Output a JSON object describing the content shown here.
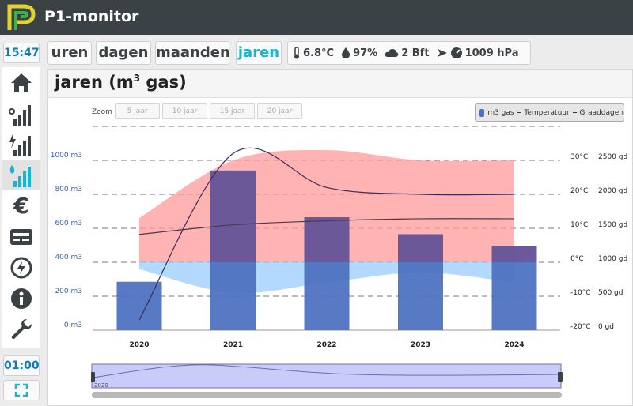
{
  "app": {
    "title": "P1-monitor"
  },
  "colors": {
    "topbar": "#3a4245",
    "accent": "#13b6d4",
    "clock": "#0b7fb5",
    "logo_yellow": "#e3d22a",
    "logo_green": "#3bb14a",
    "bar": "#4f72c0",
    "temp_band_above": "#ff9a9a",
    "temp_band_below": "#99ccff"
  },
  "clock": {
    "time": "15:47"
  },
  "sidebar": {
    "items": [
      {
        "icon": "home-icon"
      },
      {
        "icon": "signal-bars-icon"
      },
      {
        "icon": "power-bars-icon"
      },
      {
        "icon": "gas-bars-icon",
        "active": true
      },
      {
        "icon": "euro-icon"
      },
      {
        "icon": "meter-card-icon"
      },
      {
        "icon": "clock-power-icon"
      },
      {
        "icon": "info-icon"
      },
      {
        "icon": "wrench-icon"
      }
    ]
  },
  "timer": {
    "value": "01:00"
  },
  "tabs": [
    {
      "label": "uren"
    },
    {
      "label": "dagen"
    },
    {
      "label": "maanden"
    },
    {
      "label": "jaren",
      "active": true
    }
  ],
  "weather": {
    "temperature": "6.8°C",
    "humidity": "97%",
    "wind": "2 Bft",
    "pressure": "1009 hPa"
  },
  "page": {
    "title": "jaren (m",
    "title_sup": "3",
    "title_suffix": " gas)"
  },
  "zoom": {
    "label": "Zoom",
    "options": [
      "5 jaar",
      "10 jaar",
      "15 jaar",
      "20 jaar"
    ]
  },
  "legend": {
    "series_bar": "m3 gas",
    "series_temp": "Temperatuur",
    "series_degree": "Graaddagen"
  },
  "navigator": {
    "label": "2020"
  },
  "chart_data": {
    "type": "bar",
    "categories": [
      "2020",
      "2021",
      "2022",
      "2023",
      "2024"
    ],
    "series": [
      {
        "name": "m3 gas",
        "type": "bar",
        "values": [
          285,
          940,
          665,
          565,
          495
        ]
      },
      {
        "name": "Temperatuur",
        "type": "line",
        "values": [
          -17,
          32,
          22,
          20,
          20
        ]
      },
      {
        "name": "Graaddagen",
        "type": "line",
        "values": [
          1410,
          1550,
          1610,
          1640,
          1640
        ]
      }
    ],
    "temperature_range": {
      "max": [
        13,
        30,
        33,
        30,
        30
      ],
      "min": [
        -2,
        -9,
        -6,
        -3,
        -6
      ]
    },
    "y_axes": [
      {
        "ticks": [
          "0 m3",
          "200 m3",
          "400 m3",
          "600 m3",
          "800 m3",
          "1000 m3"
        ],
        "range": [
          0,
          1200
        ]
      },
      {
        "ticks": [
          "-20°C",
          "-10°C",
          "0°C",
          "10°C",
          "20°C",
          "30°C"
        ],
        "range": [
          -20,
          40
        ]
      },
      {
        "ticks": [
          "0 gd",
          "500 gd",
          "1000 gd",
          "1500 gd",
          "2000 gd",
          "2500 gd"
        ],
        "range": [
          0,
          3000
        ]
      }
    ],
    "grid": true,
    "legend_position": "top-right"
  }
}
